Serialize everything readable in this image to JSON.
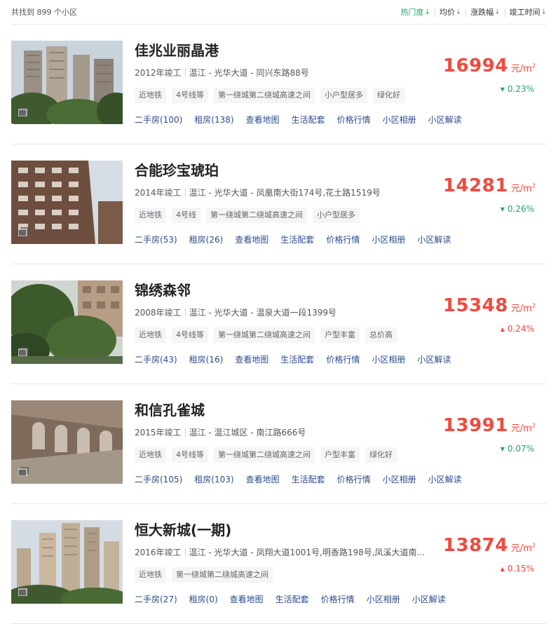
{
  "header": {
    "total_text": "共找到 899 个小区",
    "sorts": [
      {
        "label": "热门度",
        "arrow": "↓",
        "active": true
      },
      {
        "label": "均价",
        "arrow": "↓",
        "active": false
      },
      {
        "label": "涨跌幅",
        "arrow": "↓",
        "active": false
      },
      {
        "label": "竣工时间",
        "arrow": "↓",
        "active": false
      }
    ]
  },
  "colors": {
    "accent_green": "#2aa26b",
    "price_red": "#f04a3e",
    "link_blue": "#2a4c8e"
  },
  "listings": [
    {
      "name": "佳兆业丽晶港",
      "year": "2012年竣工",
      "location": "温江 - 光华大道 - 同兴东路88号",
      "tags": [
        "近地铁",
        "4号线等",
        "第一绕城第二绕城高速之间",
        "小户型居多",
        "绿化好"
      ],
      "links": [
        "二手房(100)",
        "租房(138)",
        "查看地图",
        "生活配套",
        "价格行情",
        "小区相册",
        "小区解读"
      ],
      "price": "16994",
      "unit": "元/m",
      "unit_sup": "2",
      "change": "0.23%",
      "trend": "down",
      "trend_icon": "▼"
    },
    {
      "name": "合能珍宝琥珀",
      "year": "2014年竣工",
      "location": "温江 - 光华大道 - 凤凰南大街174号,花土路1519号",
      "tags": [
        "近地铁",
        "4号线",
        "第一绕城第二绕城高速之间",
        "小户型居多"
      ],
      "links": [
        "二手房(53)",
        "租房(26)",
        "查看地图",
        "生活配套",
        "价格行情",
        "小区相册",
        "小区解读"
      ],
      "price": "14281",
      "unit": "元/m",
      "unit_sup": "2",
      "change": "0.26%",
      "trend": "down",
      "trend_icon": "▼"
    },
    {
      "name": "锦绣森邻",
      "year": "2008年竣工",
      "location": "温江 - 光华大道 - 温泉大道一段1399号",
      "tags": [
        "近地铁",
        "4号线等",
        "第一绕城第二绕城高速之间",
        "户型丰富",
        "总价高"
      ],
      "links": [
        "二手房(43)",
        "租房(16)",
        "查看地图",
        "生活配套",
        "价格行情",
        "小区相册",
        "小区解读"
      ],
      "price": "15348",
      "unit": "元/m",
      "unit_sup": "2",
      "change": "0.24%",
      "trend": "up",
      "trend_icon": "▲"
    },
    {
      "name": "和信孔雀城",
      "year": "2015年竣工",
      "location": "温江 - 温江城区 - 南江路666号",
      "tags": [
        "近地铁",
        "4号线等",
        "第一绕城第二绕城高速之间",
        "户型丰富",
        "绿化好"
      ],
      "links": [
        "二手房(105)",
        "租房(103)",
        "查看地图",
        "生活配套",
        "价格行情",
        "小区相册",
        "小区解读"
      ],
      "price": "13991",
      "unit": "元/m",
      "unit_sup": "2",
      "change": "0.07%",
      "trend": "down",
      "trend_icon": "▼"
    },
    {
      "name": "恒大新城(一期)",
      "year": "2016年竣工",
      "location": "温江 - 光华大道 - 凤翔大道1001号,明香路198号,凤溪大道南...",
      "tags": [
        "近地铁",
        "第一绕城第二绕城高速之间"
      ],
      "links": [
        "二手房(27)",
        "租房(0)",
        "查看地图",
        "生活配套",
        "价格行情",
        "小区相册",
        "小区解读"
      ],
      "price": "13874",
      "unit": "元/m",
      "unit_sup": "2",
      "change": "0.15%",
      "trend": "up",
      "trend_icon": "▲"
    }
  ]
}
